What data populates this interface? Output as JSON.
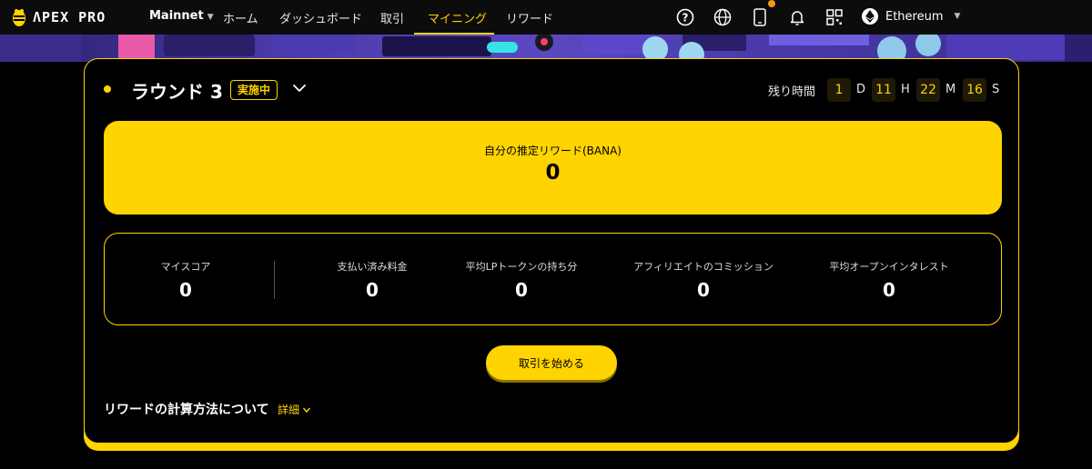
{
  "nav": {
    "logo_text": "ΛPEX PRO",
    "network": "Mainnet",
    "links": [
      "ホーム",
      "ダッシュボード",
      "取引",
      "マイニング",
      "リワード"
    ],
    "chain": "Ethereum"
  },
  "round": {
    "title": "ラウンド 3",
    "status": "実施中",
    "remaining_label": "残り時間",
    "countdown": {
      "days": "1",
      "days_unit": "D",
      "hours": "11",
      "hours_unit": "H",
      "minutes": "22",
      "minutes_unit": "M",
      "seconds": "16",
      "seconds_unit": "S"
    }
  },
  "reward": {
    "label": "自分の推定リワード(BANA)",
    "value": "0"
  },
  "stats": [
    {
      "label": "マイスコア",
      "value": "0"
    },
    {
      "label": "支払い済み料金",
      "value": "0"
    },
    {
      "label": "平均LPトークンの持ち分",
      "value": "0"
    },
    {
      "label": "アフィリエイトのコミッション",
      "value": "0"
    },
    {
      "label": "平均オープンインタレスト",
      "value": "0"
    }
  ],
  "actions": {
    "start_trading": "取引を始める"
  },
  "info": {
    "title": "リワードの計算方法について",
    "details_link": "詳細"
  },
  "colors": {
    "accent": "#ffd400",
    "background": "#000000"
  }
}
